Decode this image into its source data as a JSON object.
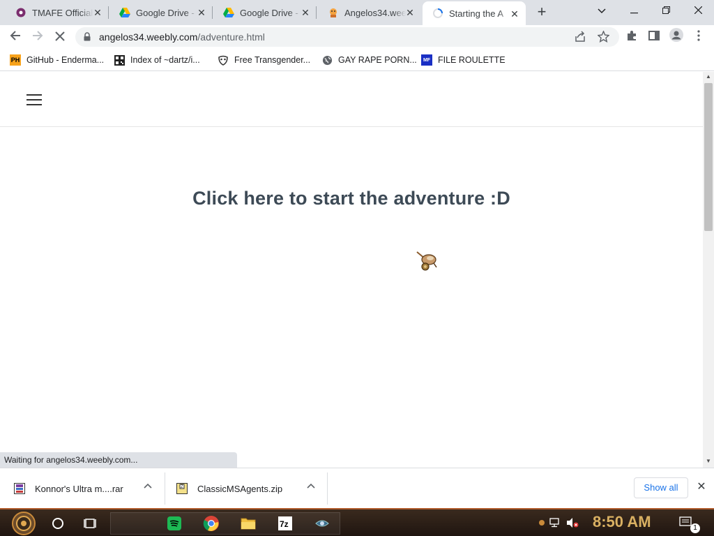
{
  "tabs": [
    {
      "title": "TMAFE Official",
      "favicon": "purple-circle-icon",
      "active": false
    },
    {
      "title": "Google Drive -",
      "favicon": "google-drive-icon",
      "active": false
    },
    {
      "title": "Google Drive -",
      "favicon": "google-drive-icon",
      "active": false
    },
    {
      "title": "Angelos34.weebly",
      "favicon": "character-icon",
      "active": false
    },
    {
      "title": "Starting the A",
      "favicon": "loading-spinner-icon",
      "active": true
    }
  ],
  "toolbar": {
    "url_domain": "angelos34.weebly.com",
    "url_path": "/adventure.html"
  },
  "bookmarks": [
    {
      "label": "GitHub - Enderma...",
      "icon": "ph-icon"
    },
    {
      "label": "Index of ~dartz/i...",
      "icon": "qr-icon"
    },
    {
      "label": "Free Transgender...",
      "icon": "mask-icon"
    },
    {
      "label": "GAY RAPE PORN...",
      "icon": "globe-icon"
    },
    {
      "label": "FILE ROULETTE",
      "icon": "mf-icon"
    }
  ],
  "page": {
    "headline": "Click here to start the adventure :D"
  },
  "status": {
    "text": "Waiting for angelos34.weebly.com..."
  },
  "downloads": [
    {
      "filename": "Konnor's Ultra m....rar",
      "icon": "rar-archive-icon"
    },
    {
      "filename": "ClassicMSAgents.zip",
      "icon": "zip-archive-icon"
    }
  ],
  "download_shelf": {
    "show_all_label": "Show all"
  },
  "taskbar": {
    "clock": "8:50 AM",
    "notification_count": "1"
  },
  "colors": {
    "headline": "#3d4a56",
    "tabstrip": "#dee1e6",
    "link_blue": "#1a73e8",
    "taskbar_accent": "#b05a2a",
    "clock": "#d9b062"
  }
}
